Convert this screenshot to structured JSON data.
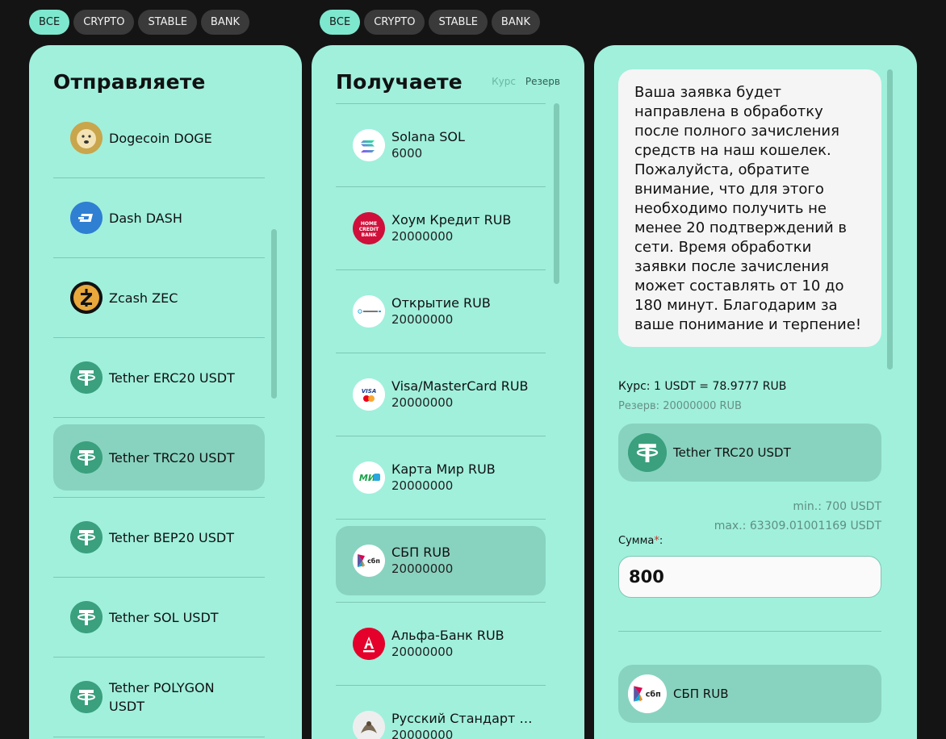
{
  "filters_left": [
    "ВСЕ",
    "CRYPTO",
    "STABLE",
    "BANK"
  ],
  "filters_right": [
    "ВСЕ",
    "CRYPTO",
    "STABLE",
    "BANK"
  ],
  "send": {
    "title": "Отправляете",
    "items": [
      {
        "label": "Dogecoin DOGE",
        "icon": "dogecoin-icon"
      },
      {
        "label": "Dash DASH",
        "icon": "dash-icon"
      },
      {
        "label": "Zcash ZEC",
        "icon": "zcash-icon"
      },
      {
        "label": "Tether ERC20 USDT",
        "icon": "tether-icon"
      },
      {
        "label": "Tether TRC20 USDT",
        "icon": "tether-icon",
        "selected": true
      },
      {
        "label": "Tether BEP20 USDT",
        "icon": "tether-icon"
      },
      {
        "label": "Tether SOL USDT",
        "icon": "tether-icon"
      },
      {
        "label": "Tether POLYGON USDT",
        "icon": "tether-icon"
      }
    ]
  },
  "receive": {
    "title": "Получаете",
    "sort_rate": "Курс",
    "sort_reserve": "Резерв",
    "items": [
      {
        "name": "Solana SOL",
        "reserve": "6000",
        "icon": "solana-icon"
      },
      {
        "name": "Хоум Кредит RUB",
        "reserve": "20000000",
        "icon": "home-credit-icon"
      },
      {
        "name": "Открытие RUB",
        "reserve": "20000000",
        "icon": "otkritie-icon"
      },
      {
        "name": "Visa/MasterCard RUB",
        "reserve": "20000000",
        "icon": "visa-mastercard-icon"
      },
      {
        "name": "Карта Мир RUB",
        "reserve": "20000000",
        "icon": "mir-icon"
      },
      {
        "name": "СБП RUB",
        "reserve": "20000000",
        "icon": "sbp-icon",
        "selected": true
      },
      {
        "name": "Альфа-Банк RUB",
        "reserve": "20000000",
        "icon": "alfa-bank-icon"
      },
      {
        "name": "Русский Стандарт RUB",
        "reserve": "20000000",
        "icon": "russian-standard-icon"
      }
    ]
  },
  "form": {
    "notice": "Ваша заявка будет направлена в обработку после полного зачисления средств на наш кошелек. Пожалуйста, обратите внимание, что для этого необходимо получить не менее 20 подтверждений в сети. Время обработки заявки после зачисления может составлять от 10 до 180 минут. Благодарим за ваше понимание и терпение!",
    "rate_label": "Курс:",
    "rate_value": "1 USDT = 78.9777 RUB",
    "reserve_label": "Резерв:",
    "reserve_value": "20000000 RUB",
    "from_currency": "Tether TRC20 USDT",
    "min": "min.: 700 USDT",
    "max": "max.: 63309.01001169 USDT",
    "sum_label": "Сумма",
    "sum_required": "*",
    "sum_suffix": ":",
    "sum_value": "800",
    "to_currency": "СБП RUB"
  },
  "colors": {
    "panel": "#a0f0dc",
    "selected": "#88d3bf",
    "active_tab": "#7ee8cf",
    "background": "#141414"
  }
}
